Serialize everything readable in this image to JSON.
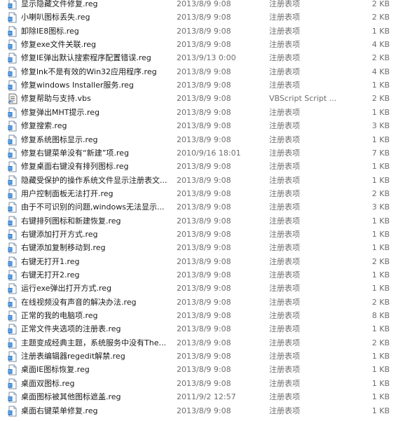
{
  "files": [
    {
      "name": "显示隐藏文件修复.reg",
      "date": "2013/8/9 9:08",
      "type": "注册表项",
      "size": "2 KB",
      "icon": "reg-file-icon"
    },
    {
      "name": "小喇叭图标丢失.reg",
      "date": "2013/8/9 9:08",
      "type": "注册表项",
      "size": "2 KB",
      "icon": "reg-file-icon"
    },
    {
      "name": "卸除IE8图标.reg",
      "date": "2013/8/9 9:08",
      "type": "注册表项",
      "size": "1 KB",
      "icon": "reg-file-icon"
    },
    {
      "name": "修复exe文件关联.reg",
      "date": "2013/8/9 9:08",
      "type": "注册表项",
      "size": "4 KB",
      "icon": "reg-file-icon"
    },
    {
      "name": "修复IE弹出默认搜索程序配置错误.reg",
      "date": "2013/9/13 0:00",
      "type": "注册表项",
      "size": "2 KB",
      "icon": "reg-file-icon"
    },
    {
      "name": "修复lnk不是有效的Win32应用程序.reg",
      "date": "2013/8/9 9:08",
      "type": "注册表项",
      "size": "4 KB",
      "icon": "reg-file-icon"
    },
    {
      "name": "修复windows Installer服务.reg",
      "date": "2013/8/9 9:08",
      "type": "注册表项",
      "size": "1 KB",
      "icon": "reg-file-icon"
    },
    {
      "name": "修复帮助与支持.vbs",
      "date": "2013/8/9 9:08",
      "type": "VBScript Script ...",
      "size": "2 KB",
      "icon": "vbs-script-icon"
    },
    {
      "name": "修复弹出MHT提示.reg",
      "date": "2013/8/9 9:08",
      "type": "注册表项",
      "size": "1 KB",
      "icon": "reg-file-icon"
    },
    {
      "name": "修复搜索.reg",
      "date": "2013/8/9 9:08",
      "type": "注册表项",
      "size": "3 KB",
      "icon": "reg-file-icon"
    },
    {
      "name": "修复系统图标显示.reg",
      "date": "2013/8/9 9:08",
      "type": "注册表项",
      "size": "1 KB",
      "icon": "reg-file-icon"
    },
    {
      "name": "修复右键菜单没有“新建”项.reg",
      "date": "2010/9/16 18:01",
      "type": "注册表项",
      "size": "7 KB",
      "icon": "reg-file-icon"
    },
    {
      "name": "修复桌面右键没有排列图标.reg",
      "date": "2013/8/9 9:08",
      "type": "注册表项",
      "size": "1 KB",
      "icon": "reg-file-icon"
    },
    {
      "name": "隐藏受保护的操作系统文件显示注册表文...",
      "date": "2013/8/9 9:08",
      "type": "注册表项",
      "size": "1 KB",
      "icon": "reg-file-icon"
    },
    {
      "name": "用户控制面板无法打开.reg",
      "date": "2013/8/9 9:08",
      "type": "注册表项",
      "size": "2 KB",
      "icon": "reg-file-icon"
    },
    {
      "name": "由于不可识别的问题,windows无法显示...",
      "date": "2013/8/9 9:08",
      "type": "注册表项",
      "size": "3 KB",
      "icon": "reg-file-icon"
    },
    {
      "name": "右键排列图标和新建恢复.reg",
      "date": "2013/8/9 9:08",
      "type": "注册表项",
      "size": "1 KB",
      "icon": "reg-file-icon"
    },
    {
      "name": "右键添加打开方式.reg",
      "date": "2013/8/9 9:08",
      "type": "注册表项",
      "size": "1 KB",
      "icon": "reg-file-icon"
    },
    {
      "name": "右键添加复制移动到.reg",
      "date": "2013/8/9 9:08",
      "type": "注册表项",
      "size": "1 KB",
      "icon": "reg-file-icon"
    },
    {
      "name": "右键无打开1.reg",
      "date": "2013/8/9 9:08",
      "type": "注册表项",
      "size": "2 KB",
      "icon": "reg-file-icon"
    },
    {
      "name": "右键无打开2.reg",
      "date": "2013/8/9 9:08",
      "type": "注册表项",
      "size": "1 KB",
      "icon": "reg-file-icon"
    },
    {
      "name": "运行exe弹出打开方式.reg",
      "date": "2013/8/9 9:08",
      "type": "注册表项",
      "size": "1 KB",
      "icon": "reg-file-icon"
    },
    {
      "name": "在线视频没有声音的解决办法.reg",
      "date": "2013/8/9 9:08",
      "type": "注册表项",
      "size": "2 KB",
      "icon": "reg-file-icon"
    },
    {
      "name": "正常的我的电脑项.reg",
      "date": "2013/8/9 9:08",
      "type": "注册表项",
      "size": "8 KB",
      "icon": "reg-file-icon"
    },
    {
      "name": "正常文件夹选项的注册表.reg",
      "date": "2013/8/9 9:08",
      "type": "注册表项",
      "size": "1 KB",
      "icon": "reg-file-icon"
    },
    {
      "name": "主题变成经典主题，系统服务中没有The...",
      "date": "2013/8/9 9:08",
      "type": "注册表项",
      "size": "2 KB",
      "icon": "reg-file-icon"
    },
    {
      "name": "注册表编辑器regedit解禁.reg",
      "date": "2013/8/9 9:08",
      "type": "注册表项",
      "size": "1 KB",
      "icon": "reg-file-icon"
    },
    {
      "name": "桌面IE图标恢复.reg",
      "date": "2013/8/9 9:08",
      "type": "注册表项",
      "size": "1 KB",
      "icon": "reg-file-icon"
    },
    {
      "name": "桌面双图标.reg",
      "date": "2013/8/9 9:08",
      "type": "注册表项",
      "size": "1 KB",
      "icon": "reg-file-icon"
    },
    {
      "name": "桌面图标被其他图标遮盖.reg",
      "date": "2011/9/2 12:57",
      "type": "注册表项",
      "size": "1 KB",
      "icon": "reg-file-icon"
    },
    {
      "name": "桌面右键菜单修复.reg",
      "date": "2013/8/9 9:08",
      "type": "注册表项",
      "size": "1 KB",
      "icon": "reg-file-icon"
    }
  ]
}
